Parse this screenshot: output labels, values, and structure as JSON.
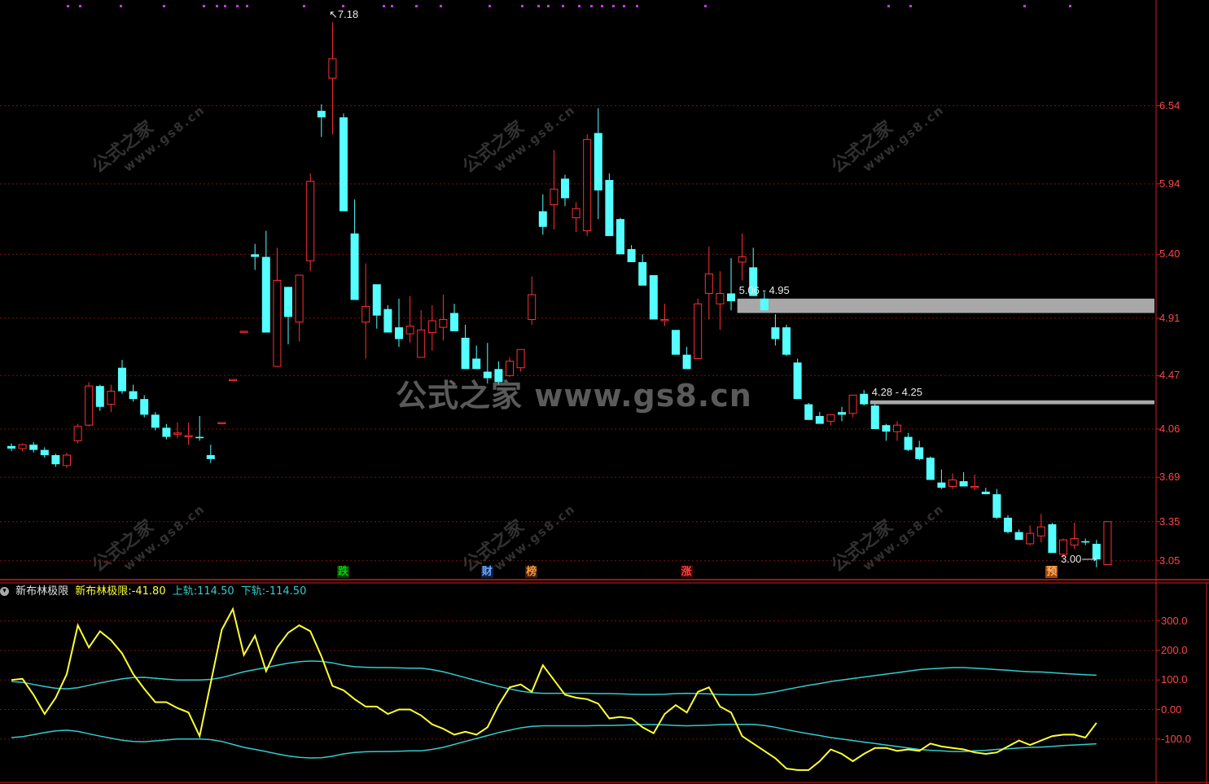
{
  "watermark": {
    "main": "公式之家 www.gs8.cn",
    "small_title": "公式之家",
    "small_url": "www.gs8.cn"
  },
  "price_axis": [
    "6.54",
    "5.94",
    "5.40",
    "4.91",
    "4.47",
    "4.06",
    "3.69",
    "3.35",
    "3.05"
  ],
  "indicator_axis": [
    "300.0",
    "200.0",
    "100.0",
    "0.00",
    "-100.0"
  ],
  "peak_label": "7.18",
  "low_label": "3.00",
  "zones": [
    {
      "label": "5.06 - 4.95",
      "hi": 5.06,
      "lo": 4.95,
      "color": "#a8a8a8"
    },
    {
      "label": "4.28 - 4.25",
      "hi": 4.28,
      "lo": 4.25,
      "color": "#a8a8a8"
    }
  ],
  "event_marks": [
    {
      "text": "跌",
      "color": "#00d000",
      "bg": "#0b3a0b",
      "bar": 30
    },
    {
      "text": "财",
      "color": "#6fa8ff",
      "bg": "#0b1f44",
      "bar": 43
    },
    {
      "text": "榜",
      "color": "#ff9a3a",
      "bg": "#3f1c08",
      "bar": 47
    },
    {
      "text": "涨",
      "color": "#ff4040",
      "bg": "#3d0808",
      "bar": 61
    },
    {
      "text": "预",
      "color": "#ffb060",
      "bg": "#a0460c",
      "bar": 94
    }
  ],
  "indicator": {
    "icon": "chevron-down-icon",
    "name": "新布林极限",
    "value_label": "新布林极限:",
    "value": "-41.80",
    "upper_label": "上轨:",
    "upper": "114.50",
    "lower_label": "下轨:",
    "lower": "-114.50",
    "line_color": "#ffff33",
    "band_color": "#33cccc"
  },
  "chart_data": {
    "type": "candlestick",
    "up_color": "#ff3030",
    "down_color": "#55ffff",
    "ylim": [
      2.98,
      7.3
    ],
    "candles": [
      [
        3.93,
        3.95,
        3.89,
        3.91
      ],
      [
        3.91,
        3.95,
        3.89,
        3.94
      ],
      [
        3.94,
        3.96,
        3.88,
        3.9
      ],
      [
        3.9,
        3.92,
        3.84,
        3.86
      ],
      [
        3.86,
        3.87,
        3.77,
        3.79
      ],
      [
        3.78,
        3.88,
        3.76,
        3.86
      ],
      [
        3.97,
        4.1,
        3.95,
        4.08
      ],
      [
        4.09,
        4.42,
        4.08,
        4.39
      ],
      [
        4.39,
        4.4,
        4.2,
        4.23
      ],
      [
        4.25,
        4.4,
        4.19,
        4.35
      ],
      [
        4.53,
        4.59,
        4.33,
        4.35
      ],
      [
        4.35,
        4.4,
        4.27,
        4.29
      ],
      [
        4.29,
        4.32,
        4.15,
        4.17
      ],
      [
        4.17,
        4.19,
        4.05,
        4.07
      ],
      [
        4.07,
        4.1,
        3.98,
        4.0
      ],
      [
        4.02,
        4.11,
        3.99,
        4.03
      ],
      [
        4.01,
        4.11,
        3.94,
        4.01
      ],
      [
        4.0,
        4.16,
        3.97,
        3.99
      ],
      [
        3.86,
        3.94,
        3.8,
        3.83
      ],
      [
        4.11,
        4.11,
        4.11,
        4.11
      ],
      [
        4.44,
        4.44,
        4.44,
        4.44
      ],
      [
        4.81,
        4.81,
        4.81,
        4.81
      ],
      [
        5.4,
        5.48,
        5.28,
        5.38
      ],
      [
        5.38,
        5.58,
        5.02,
        4.8
      ],
      [
        4.54,
        5.45,
        4.54,
        5.2
      ],
      [
        5.15,
        5.15,
        4.71,
        4.92
      ],
      [
        4.88,
        5.24,
        4.73,
        5.24
      ],
      [
        5.35,
        6.02,
        5.27,
        5.96
      ],
      [
        6.5,
        6.55,
        6.3,
        6.45
      ],
      [
        6.75,
        7.18,
        6.32,
        6.9
      ],
      [
        6.45,
        6.48,
        5.73,
        5.73
      ],
      [
        5.56,
        5.82,
        5.26,
        5.05
      ],
      [
        4.88,
        5.33,
        4.6,
        5.0
      ],
      [
        5.17,
        5.13,
        4.83,
        4.93
      ],
      [
        4.98,
        5.01,
        4.81,
        4.8
      ],
      [
        4.84,
        5.06,
        4.69,
        4.75
      ],
      [
        4.79,
        5.08,
        4.72,
        4.85
      ],
      [
        4.61,
        4.97,
        4.66,
        4.82
      ],
      [
        4.8,
        5.01,
        4.66,
        4.89
      ],
      [
        4.84,
        5.09,
        4.74,
        4.9
      ],
      [
        4.95,
        5.02,
        4.87,
        4.81
      ],
      [
        4.76,
        4.86,
        4.55,
        4.52
      ],
      [
        4.6,
        4.7,
        4.55,
        4.52
      ],
      [
        4.5,
        4.72,
        4.41,
        4.45
      ],
      [
        4.52,
        4.58,
        4.4,
        4.42
      ],
      [
        4.47,
        4.61,
        4.46,
        4.58
      ],
      [
        4.53,
        4.64,
        4.5,
        4.67
      ],
      [
        4.9,
        5.23,
        4.86,
        5.09
      ],
      [
        5.73,
        5.86,
        5.55,
        5.61
      ],
      [
        5.78,
        6.2,
        5.59,
        5.9
      ],
      [
        5.98,
        6.01,
        5.77,
        5.83
      ],
      [
        5.68,
        5.8,
        5.57,
        5.75
      ],
      [
        5.58,
        6.32,
        5.54,
        6.28
      ],
      [
        6.33,
        6.52,
        5.67,
        5.89
      ],
      [
        5.97,
        6.02,
        5.54,
        5.54
      ],
      [
        5.67,
        5.68,
        5.55,
        5.4
      ],
      [
        5.44,
        5.47,
        5.34,
        5.34
      ],
      [
        5.34,
        5.4,
        5.21,
        5.16
      ],
      [
        5.24,
        5.24,
        4.92,
        4.9
      ],
      [
        4.9,
        5.02,
        4.85,
        4.9
      ],
      [
        4.82,
        4.8,
        4.67,
        4.63
      ],
      [
        4.63,
        4.69,
        4.58,
        4.52
      ],
      [
        4.6,
        5.06,
        4.6,
        5.02
      ],
      [
        5.1,
        5.46,
        4.9,
        5.25
      ],
      [
        5.02,
        5.27,
        4.82,
        5.1
      ],
      [
        5.1,
        5.37,
        4.97,
        5.04
      ],
      [
        5.34,
        5.56,
        5.2,
        5.38
      ],
      [
        5.3,
        5.45,
        5.15,
        5.08
      ],
      [
        5.06,
        5.11,
        4.97,
        4.97
      ],
      [
        4.84,
        4.94,
        4.7,
        4.75
      ],
      [
        4.84,
        4.86,
        4.62,
        4.63
      ],
      [
        4.57,
        4.6,
        4.29,
        4.29
      ],
      [
        4.25,
        4.26,
        4.13,
        4.13
      ],
      [
        4.16,
        4.19,
        4.12,
        4.1
      ],
      [
        4.12,
        4.13,
        4.09,
        4.17
      ],
      [
        4.19,
        4.23,
        4.12,
        4.17
      ],
      [
        4.18,
        4.29,
        4.15,
        4.32
      ],
      [
        4.33,
        4.36,
        4.24,
        4.25
      ],
      [
        4.24,
        4.25,
        4.06,
        4.06
      ],
      [
        4.09,
        4.1,
        3.97,
        4.04
      ],
      [
        4.04,
        4.12,
        3.97,
        4.09
      ],
      [
        4.0,
        4.03,
        3.89,
        3.9
      ],
      [
        3.92,
        3.97,
        3.82,
        3.83
      ],
      [
        3.84,
        3.85,
        3.67,
        3.67
      ],
      [
        3.65,
        3.75,
        3.6,
        3.61
      ],
      [
        3.62,
        3.72,
        3.6,
        3.67
      ],
      [
        3.66,
        3.73,
        3.62,
        3.62
      ],
      [
        3.62,
        3.71,
        3.59,
        3.62
      ],
      [
        3.58,
        3.61,
        3.56,
        3.56
      ],
      [
        3.56,
        3.6,
        3.37,
        3.38
      ],
      [
        3.38,
        3.4,
        3.26,
        3.27
      ],
      [
        3.27,
        3.29,
        3.21,
        3.21
      ],
      [
        3.18,
        3.32,
        3.17,
        3.26
      ],
      [
        3.24,
        3.41,
        3.19,
        3.31
      ],
      [
        3.33,
        3.34,
        3.11,
        3.11
      ],
      [
        3.1,
        3.22,
        3.07,
        3.21
      ],
      [
        3.17,
        3.34,
        3.14,
        3.22
      ],
      [
        3.2,
        3.22,
        3.17,
        3.19
      ],
      [
        3.18,
        3.21,
        3.0,
        3.06
      ],
      [
        3.02,
        3.35,
        3.02,
        3.35
      ]
    ],
    "indicator_ylim": [
      -230,
      390
    ],
    "indicator_series": {
      "line": [
        100,
        104,
        50,
        -15,
        40,
        120,
        285,
        210,
        265,
        235,
        190,
        120,
        70,
        25,
        25,
        5,
        -10,
        -90,
        90,
        270,
        340,
        185,
        250,
        130,
        210,
        260,
        285,
        265,
        180,
        80,
        65,
        35,
        10,
        10,
        -15,
        0,
        0,
        -20,
        -50,
        -65,
        -85,
        -75,
        -85,
        -60,
        15,
        75,
        85,
        60,
        150,
        100,
        50,
        40,
        35,
        20,
        -30,
        -25,
        -30,
        -60,
        -80,
        -15,
        15,
        -10,
        60,
        75,
        10,
        -10,
        -90,
        -115,
        -140,
        -165,
        -200,
        -205,
        -205,
        -175,
        -135,
        -150,
        -175,
        -150,
        -130,
        -130,
        -140,
        -135,
        -140,
        -115,
        -125,
        -130,
        -135,
        -145,
        -150,
        -145,
        -125,
        -105,
        -120,
        -105,
        -90,
        -85,
        -85,
        -95,
        -45
      ],
      "upper": [
        95,
        92,
        85,
        78,
        72,
        70,
        74,
        82,
        90,
        97,
        104,
        108,
        109,
        106,
        103,
        100,
        100,
        100,
        102,
        108,
        118,
        128,
        135,
        142,
        150,
        157,
        162,
        164,
        163,
        158,
        150,
        145,
        143,
        142,
        142,
        141,
        140,
        140,
        135,
        128,
        118,
        108,
        98,
        88,
        78,
        70,
        62,
        57,
        55,
        55,
        55,
        55,
        55,
        54,
        54,
        53,
        52,
        51,
        51,
        52,
        54,
        55,
        54,
        53,
        51,
        50,
        50,
        50,
        54,
        60,
        68,
        75,
        82,
        88,
        95,
        100,
        105,
        110,
        115,
        120,
        125,
        130,
        135,
        138,
        140,
        142,
        142,
        140,
        138,
        135,
        133,
        130,
        128,
        127,
        125,
        122,
        120,
        118,
        116
      ],
      "lower": [
        -95,
        -92,
        -85,
        -78,
        -72,
        -70,
        -74,
        -82,
        -90,
        -97,
        -104,
        -108,
        -109,
        -106,
        -103,
        -100,
        -100,
        -100,
        -102,
        -108,
        -118,
        -128,
        -135,
        -142,
        -150,
        -157,
        -162,
        -164,
        -163,
        -158,
        -150,
        -145,
        -143,
        -142,
        -142,
        -141,
        -140,
        -140,
        -135,
        -128,
        -118,
        -108,
        -98,
        -88,
        -78,
        -70,
        -62,
        -57,
        -55,
        -55,
        -55,
        -55,
        -55,
        -54,
        -54,
        -53,
        -52,
        -51,
        -51,
        -52,
        -54,
        -55,
        -54,
        -53,
        -51,
        -50,
        -50,
        -50,
        -54,
        -60,
        -68,
        -75,
        -82,
        -88,
        -95,
        -100,
        -105,
        -110,
        -115,
        -120,
        -125,
        -130,
        -135,
        -138,
        -140,
        -142,
        -142,
        -140,
        -138,
        -135,
        -133,
        -130,
        -128,
        -127,
        -125,
        -122,
        -120,
        -118,
        -116
      ]
    }
  }
}
